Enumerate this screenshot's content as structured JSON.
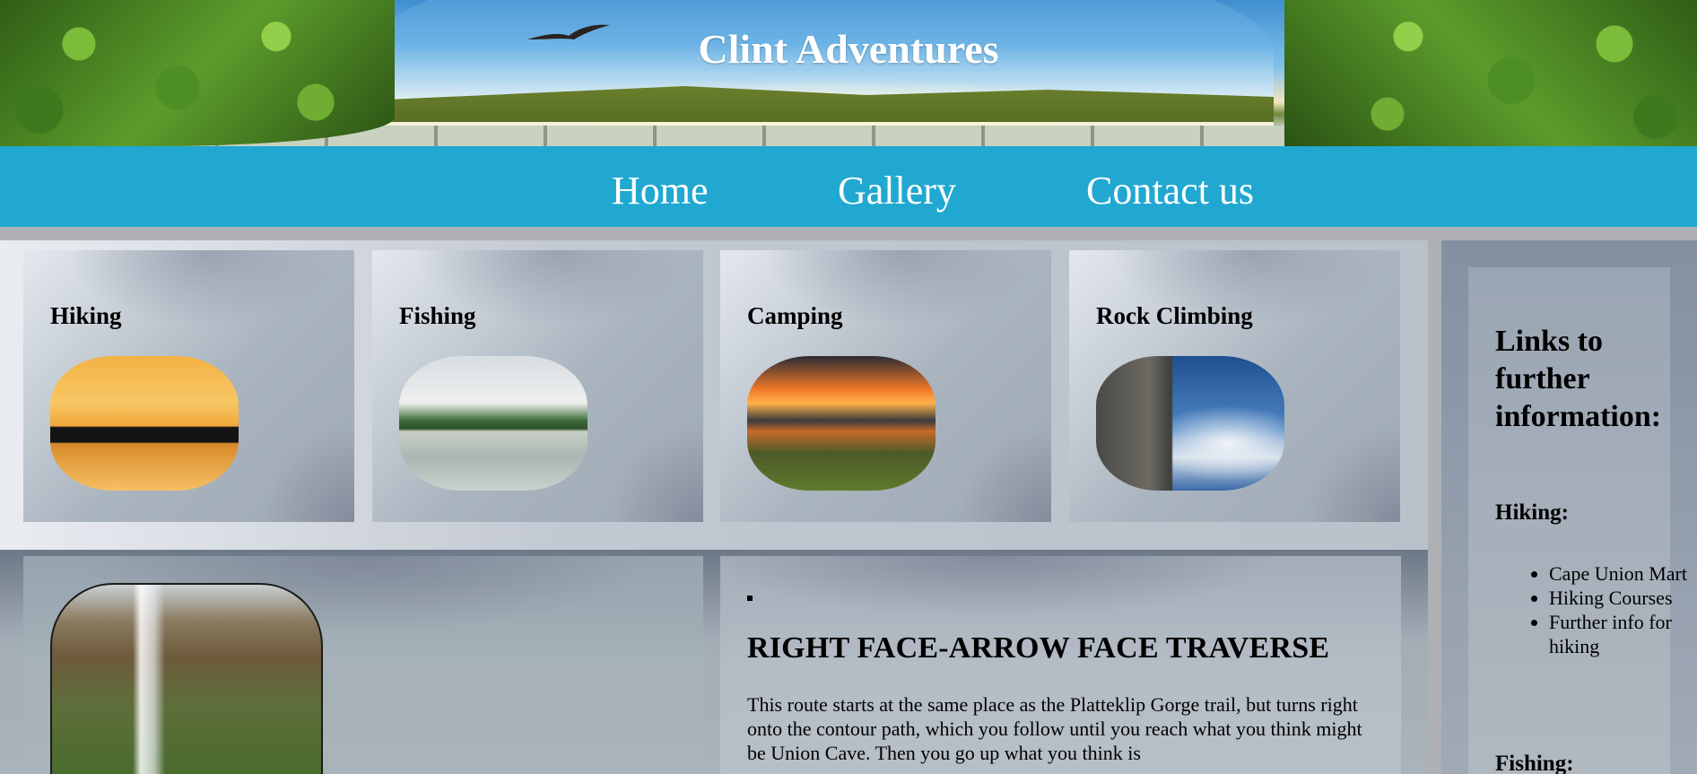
{
  "header": {
    "title": "Clint Adventures"
  },
  "nav": {
    "items": [
      {
        "label": "Home"
      },
      {
        "label": "Gallery"
      },
      {
        "label": "Contact us"
      }
    ]
  },
  "activities": [
    {
      "title": "Hiking"
    },
    {
      "title": "Fishing"
    },
    {
      "title": "Camping"
    },
    {
      "title": "Rock Climbing"
    }
  ],
  "feature": {
    "heading": "RIGHT FACE-ARROW FACE TRAVERSE",
    "body": "This route starts at the same place as the Platteklip Gorge trail, but turns right onto the contour path, which you follow until you reach what you think might be Union Cave. Then you go up what you think is"
  },
  "sidebar": {
    "title": "Links to further information:",
    "sections": [
      {
        "heading": "Hiking:",
        "links": [
          "Cape Union Mart",
          "Hiking Courses",
          "Further info for hiking"
        ]
      },
      {
        "heading": "Fishing:"
      }
    ]
  },
  "colors": {
    "nav_background": "#20a8d0",
    "nav_text": "#ffffff",
    "title_text": "#ffffff"
  }
}
